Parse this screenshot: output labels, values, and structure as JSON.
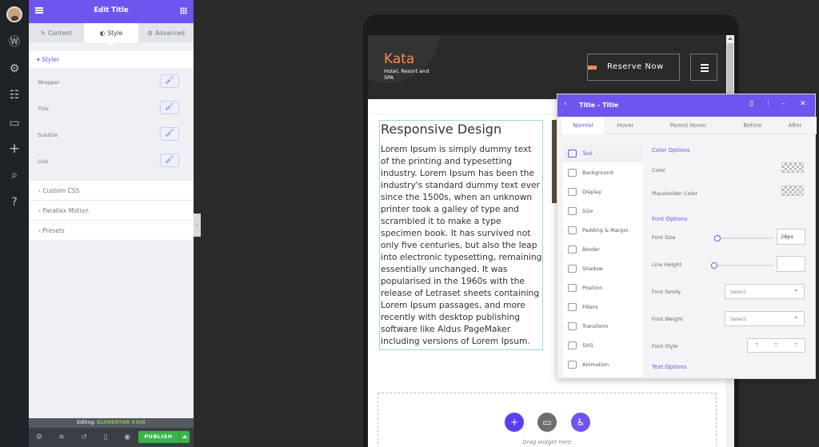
{
  "panel": {
    "title": "Edit Title",
    "tabs": [
      {
        "label": "Content"
      },
      {
        "label": "Style"
      },
      {
        "label": "Advanced"
      }
    ],
    "styler_label": "Styler",
    "styler_rows": [
      "Wrapper",
      "Title",
      "Subtitle",
      "Link"
    ],
    "collapsed_sections": [
      "Custom CSS",
      "Parallax Motion",
      "Presets"
    ],
    "editing_prefix": "Editing:",
    "editing_name": "ELEMENTOR #508",
    "publish_label": "PUBLISH"
  },
  "site": {
    "logo": "Kata",
    "logo_sub": "Hotel, Resort and SPA",
    "reserve_label": "Reserve Now",
    "heading": "Responsive Design",
    "body": "Lorem Ipsum is simply dummy text of the printing and typesetting industry. Lorem Ipsum has been the industry's standard dummy text ever since the 1500s, when an unknown printer took a galley of type and scrambled it to make a type specimen book. It has survived not only five centuries, but also the leap into electronic typesetting, remaining essentially unchanged. It was popularised in the 1960s with the release of Letraset sheets containing Lorem Ipsum passages, and more recently with desktop publishing software like Aldus PageMaker including versions of Lorem Ipsum.",
    "drag_text": "Drag widget here"
  },
  "float_panel": {
    "title": "Title - Title",
    "state_tabs": [
      "Normal",
      "Hover",
      "Parent Hover",
      "Before",
      "After"
    ],
    "side_items": [
      "Text",
      "Background",
      "Display",
      "Size",
      "Padding & Margin",
      "Border",
      "Shadow",
      "Position",
      "Filters",
      "Transform",
      "SVG",
      "Animation"
    ],
    "color_options": "Color Options",
    "color_label": "Color",
    "placeholder_color_label": "Placeholder Color",
    "font_options": "Font Options",
    "font_size_label": "Font Size",
    "font_size_value": "28px",
    "line_height_label": "Line Height",
    "font_family_label": "Font family",
    "font_weight_label": "Font Weight",
    "select_placeholder": "Select",
    "font_style_label": "Font Style",
    "font_style_opts": [
      "T",
      "T",
      "T"
    ],
    "text_options": "Text Options"
  },
  "colors": {
    "accent": "#6f54ef",
    "publish": "#39b54a",
    "logo": "#f48a5b"
  }
}
